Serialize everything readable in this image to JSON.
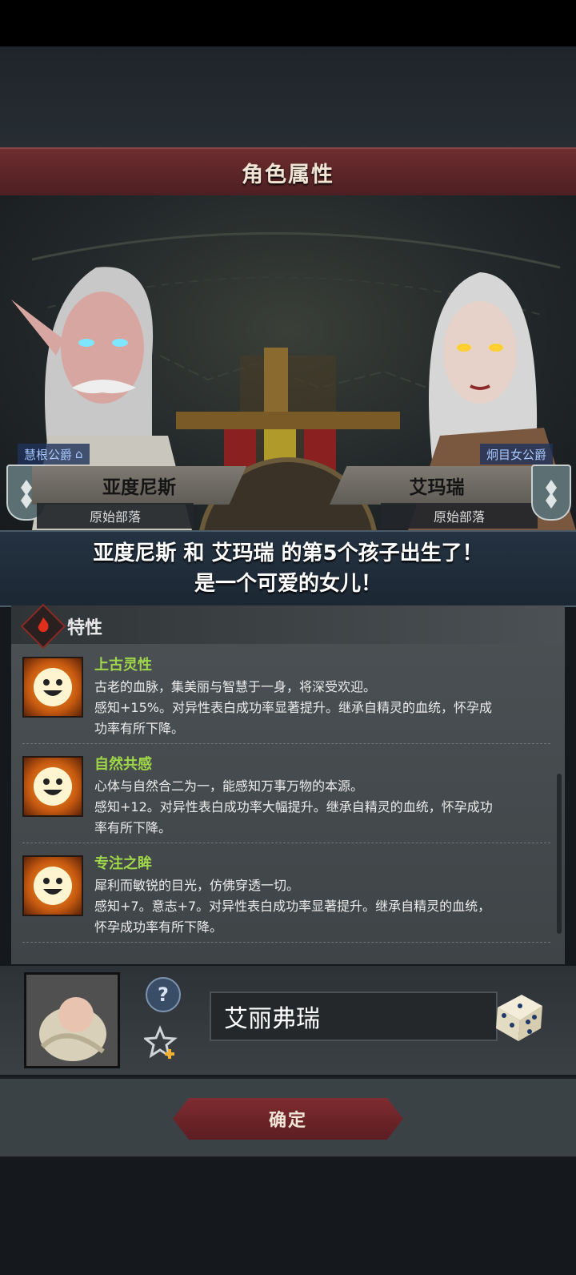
{
  "header": {
    "title": "角色属性"
  },
  "father": {
    "title": "慧根公爵",
    "name": "亚度尼斯",
    "tribe": "原始部落"
  },
  "mother": {
    "title": "炯目女公爵",
    "name": "艾玛瑞",
    "tribe": "原始部落"
  },
  "announcement": {
    "line1": "亚度尼斯 和 艾玛瑞 的第5个孩子出生了！",
    "line2": "是一个可爱的女儿！"
  },
  "traits": {
    "header": "特性",
    "items": [
      {
        "name": "上古灵性",
        "lines": [
          "古老的血脉，集美丽与智慧于一身，将深受欢迎。",
          "感知+15%。对异性表白成功率显著提升。继承自精灵的血统，怀孕成",
          "功率有所下降。"
        ]
      },
      {
        "name": "自然共感",
        "lines": [
          "心体与自然合二为一，能感知万事万物的本源。",
          "感知+12。对异性表白成功率大幅提升。继承自精灵的血统，怀孕成功",
          "率有所下降。"
        ]
      },
      {
        "name": "专注之眸",
        "lines": [
          "犀利而敏锐的目光，仿佛穿透一切。",
          "感知+7。意志+7。对异性表白成功率显著提升。继承自精灵的血统，",
          "怀孕成功率有所下降。"
        ]
      }
    ]
  },
  "naming": {
    "help_symbol": "?",
    "child_name": "艾丽弗瑞"
  },
  "confirm_label": "确定",
  "colors": {
    "accent_red": "#6e2d2f",
    "trait_green": "#9fd64a",
    "title_blue": "#a9c8ff"
  },
  "icons": [
    "home-icon",
    "fire-icon",
    "smiley-trait-icon",
    "help-icon",
    "star-plus-icon",
    "dice-icon",
    "house-shield-icon"
  ]
}
